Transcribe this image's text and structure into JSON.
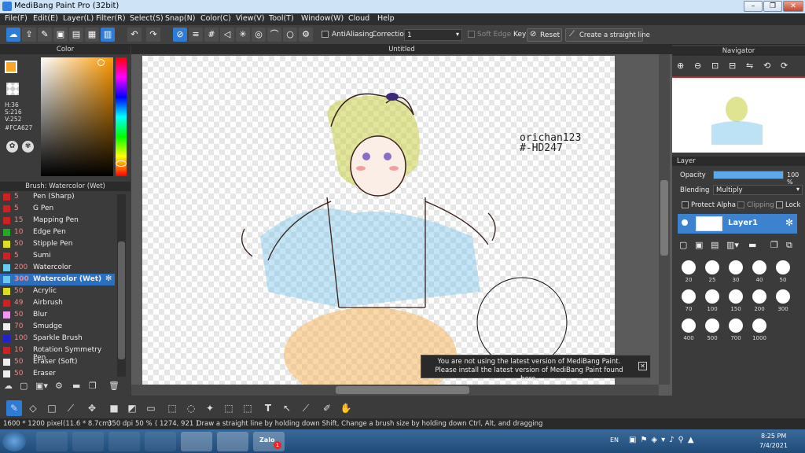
{
  "window": {
    "title": "MediBang Paint Pro (32bit)"
  },
  "menu": [
    "File(F)",
    "Edit(E)",
    "Layer(L)",
    "Filter(R)",
    "Select(S)",
    "Snap(N)",
    "Color(C)",
    "View(V)",
    "Tool(T)",
    "Window(W)",
    "Cloud",
    "Help"
  ],
  "toolbar": {
    "antialiasing_label": "AntiAliasing",
    "correction_label": "Correction",
    "correction_value": "1",
    "soft_edge_label": "Soft Edge",
    "key_label": "Key",
    "reset_label": "Reset",
    "straight_line_label": "Create a straight line"
  },
  "color_panel": {
    "title": "Color",
    "h": "H:36",
    "s": "S:216",
    "v": "V:252",
    "hex": "#FCA627",
    "fg_color": "#FCA627"
  },
  "brush_panel": {
    "title": "Brush: Watercolor (Wet)",
    "items": [
      {
        "size": "5",
        "name": "Pen (Sharp)",
        "color": "#cc2222"
      },
      {
        "size": "5",
        "name": "G Pen",
        "color": "#cc2222"
      },
      {
        "size": "15",
        "name": "Mapping Pen",
        "color": "#cc2222"
      },
      {
        "size": "10",
        "name": "Edge Pen",
        "color": "#22aa22"
      },
      {
        "size": "50",
        "name": "Stipple Pen",
        "color": "#dddd22"
      },
      {
        "size": "5",
        "name": "Sumi",
        "color": "#cc2222"
      },
      {
        "size": "200",
        "name": "Watercolor",
        "color": "#66ccee"
      },
      {
        "size": "300",
        "name": "Watercolor (Wet)",
        "color": "#66ccee"
      },
      {
        "size": "50",
        "name": "Acrylic",
        "color": "#dddd22"
      },
      {
        "size": "49",
        "name": "Airbrush",
        "color": "#cc2222"
      },
      {
        "size": "50",
        "name": "Blur",
        "color": "#ee99ee"
      },
      {
        "size": "70",
        "name": "Smudge",
        "color": "#eeeeee"
      },
      {
        "size": "100",
        "name": "Sparkle Brush",
        "color": "#2222cc"
      },
      {
        "size": "10",
        "name": "Rotation Symmetry Pen",
        "color": "#cc2222"
      },
      {
        "size": "50",
        "name": "Eraser (Soft)",
        "color": "#eeeeee"
      },
      {
        "size": "50",
        "name": "Eraser",
        "color": "#eeeeee"
      }
    ]
  },
  "canvas": {
    "tab_title": "Untitled",
    "signature_line1": "orichan123",
    "signature_line2": "#-HD247"
  },
  "notification": {
    "line1": "You are not using the latest version of MediBang Paint.",
    "line2": "Please install the latest version of MediBang Paint found here."
  },
  "navigator": {
    "title": "Navigator"
  },
  "layer_panel": {
    "title": "Layer",
    "opacity_label": "Opacity",
    "opacity_value": "100 %",
    "opacity_level": 1.0,
    "blending_label": "Blending",
    "blending_value": "Multiply",
    "protect_alpha_label": "Protect Alpha",
    "clipping_label": "Clipping",
    "lock_label": "Lock",
    "layer_name": "Layer1"
  },
  "brush_sizes": [
    "20",
    "25",
    "30",
    "40",
    "50",
    "70",
    "100",
    "150",
    "200",
    "300",
    "400",
    "500",
    "700",
    "1000"
  ],
  "status": {
    "dimensions": "1600 * 1200 pixel",
    "physical": "(11.6 * 8.7cm)",
    "dpi": "350 dpi",
    "zoom": "50 %",
    "coords": "( 1274, 921 )",
    "hint": "Draw a straight line by holding down Shift, Change a brush size by holding down Ctrl, Alt, and dragging"
  },
  "taskbar": {
    "lang": "EN",
    "time": "8:25 PM",
    "date": "7/4/2021",
    "zalo_label": "Zalo",
    "zalo_badge": "1"
  }
}
